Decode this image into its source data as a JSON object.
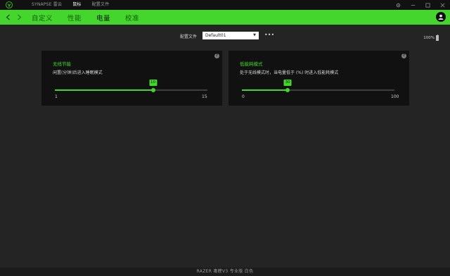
{
  "titlebar": {
    "tabs": [
      {
        "label": "SYNAPSE 雷云",
        "active": false
      },
      {
        "label": "鼠标",
        "active": true
      },
      {
        "label": "配置文件",
        "active": false
      }
    ]
  },
  "navbar": {
    "tabs": [
      {
        "label": "自定义"
      },
      {
        "label": "性能"
      },
      {
        "label": "电量"
      },
      {
        "label": "校准"
      }
    ],
    "active_index": 2
  },
  "profile": {
    "label": "配置文件",
    "selected": "Default01",
    "more_label": "•••"
  },
  "battery": {
    "percent_text": "100%"
  },
  "cards": [
    {
      "title": "无线节能",
      "description": "闲置(分钟)后进入睡眠模式",
      "slider": {
        "min": 1,
        "max": 15,
        "value": 10,
        "min_label": "1",
        "max_label": "15",
        "value_label": "10"
      }
    },
    {
      "title": "低能耗模式",
      "description": "处于无线模式时，当电量低于 (%) 时进入低能耗模式",
      "slider": {
        "min": 0,
        "max": 100,
        "value": 30,
        "min_label": "0",
        "max_label": "100",
        "value_label": "30"
      }
    }
  ],
  "footer": {
    "device_name": "RAZER 毒蝰V3 专业版 白色"
  },
  "colors": {
    "accent": "#44d62c",
    "background": "#242424",
    "card": "#111111"
  }
}
